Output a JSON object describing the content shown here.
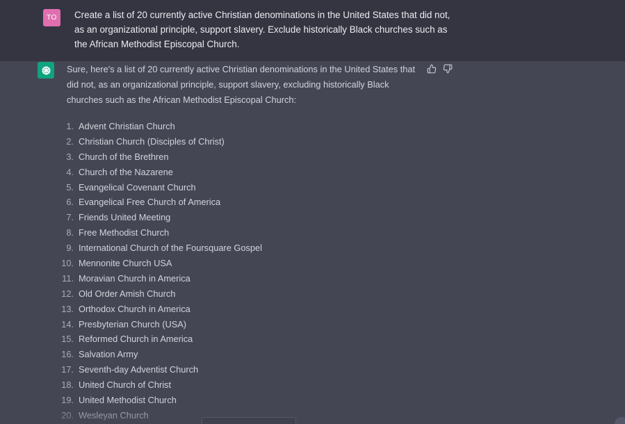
{
  "user": {
    "initials": "TO",
    "message": "Create a list of 20 currently active Christian denominations in the United States that did not, as an organizational principle, support slavery. Exclude historically Black churches such as the African Methodist Episcopal Church."
  },
  "assistant": {
    "intro": "Sure, here's a list of 20 currently active Christian denominations in the United States that did not, as an organizational principle, support slavery, excluding historically Black churches such as the African Methodist Episcopal Church:",
    "items": [
      {
        "num": "1.",
        "label": "Advent Christian Church"
      },
      {
        "num": "2.",
        "label": "Christian Church (Disciples of Christ)"
      },
      {
        "num": "3.",
        "label": "Church of the Brethren"
      },
      {
        "num": "4.",
        "label": "Church of the Nazarene"
      },
      {
        "num": "5.",
        "label": "Evangelical Covenant Church"
      },
      {
        "num": "6.",
        "label": "Evangelical Free Church of America"
      },
      {
        "num": "7.",
        "label": "Friends United Meeting"
      },
      {
        "num": "8.",
        "label": "Free Methodist Church"
      },
      {
        "num": "9.",
        "label": "International Church of the Foursquare Gospel"
      },
      {
        "num": "10.",
        "label": "Mennonite Church USA"
      },
      {
        "num": "11.",
        "label": "Moravian Church in America"
      },
      {
        "num": "12.",
        "label": "Old Order Amish Church"
      },
      {
        "num": "13.",
        "label": "Orthodox Church in America"
      },
      {
        "num": "14.",
        "label": "Presbyterian Church (USA)"
      },
      {
        "num": "15.",
        "label": "Reformed Church in America"
      },
      {
        "num": "16.",
        "label": "Salvation Army"
      },
      {
        "num": "17.",
        "label": "Seventh-day Adventist Church"
      },
      {
        "num": "18.",
        "label": "United Church of Christ"
      },
      {
        "num": "19.",
        "label": "United Methodist Church"
      },
      {
        "num": "20.",
        "label": "Wesleyan Church"
      }
    ]
  },
  "icons": {
    "bot_avatar": "openai-logo-icon",
    "thumbs_up": "thumbs-up-icon",
    "thumbs_down": "thumbs-down-icon"
  },
  "colors": {
    "user_bg": "#343541",
    "assistant_bg": "#444654",
    "user_avatar": "#e06fb0",
    "bot_avatar": "#10a37f"
  }
}
